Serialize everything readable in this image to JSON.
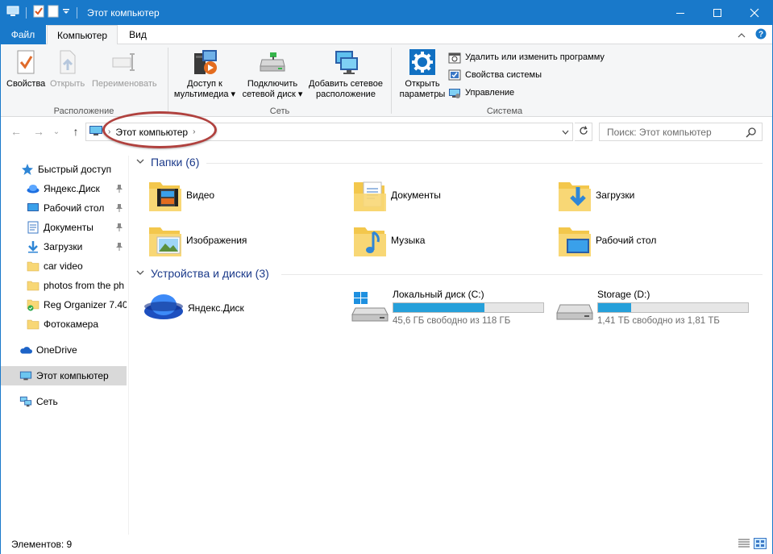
{
  "window": {
    "title": "Этот компьютер",
    "minimize_glyph": "—",
    "maximize_glyph": "☐",
    "close_glyph": "✕"
  },
  "ribbon_tabs": {
    "file": "Файл",
    "computer": "Компьютер",
    "view": "Вид"
  },
  "ribbon": {
    "location_group": {
      "label": "Расположение",
      "properties": "Свойства",
      "open": "Открыть",
      "rename": "Переименовать"
    },
    "network_group": {
      "label": "Сеть",
      "media_access_line1": "Доступ к",
      "media_access_line2": "мультимедиа",
      "map_drive_line1": "Подключить",
      "map_drive_line2": "сетевой диск",
      "add_location_line1": "Добавить сетевое",
      "add_location_line2": "расположение"
    },
    "system_group": {
      "label": "Система",
      "open_settings_line1": "Открыть",
      "open_settings_line2": "параметры",
      "uninstall": "Удалить или изменить программу",
      "system_properties": "Свойства системы",
      "manage": "Управление"
    },
    "dropdown_glyph": "▾"
  },
  "address": {
    "crumb": "Этот компьютер",
    "chevron": "›",
    "search_placeholder": "Поиск: Этот компьютер"
  },
  "nav": {
    "back": "←",
    "forward": "→",
    "recent": "⌄",
    "up": "↑",
    "items": [
      {
        "label": "Быстрый доступ",
        "icon": "star-icon",
        "pinned": false
      },
      {
        "label": "Яндекс.Диск",
        "icon": "yandex-disk-icon",
        "pinned": true
      },
      {
        "label": "Рабочий стол",
        "icon": "desktop-icon",
        "pinned": true
      },
      {
        "label": "Документы",
        "icon": "documents-icon",
        "pinned": true
      },
      {
        "label": "Загрузки",
        "icon": "downloads-icon",
        "pinned": true
      },
      {
        "label": "car video",
        "icon": "folder-icon",
        "pinned": false
      },
      {
        "label": "photos from the ph",
        "icon": "folder-icon",
        "pinned": false
      },
      {
        "label": "Reg Organizer 7.40",
        "icon": "folder-check-icon",
        "pinned": false
      },
      {
        "label": "Фотокамера",
        "icon": "folder-icon",
        "pinned": false
      },
      {
        "label": "OneDrive",
        "icon": "onedrive-icon",
        "pinned": false
      },
      {
        "label": "Этот компьютер",
        "icon": "this-pc-icon",
        "pinned": false
      },
      {
        "label": "Сеть",
        "icon": "network-icon",
        "pinned": false
      }
    ]
  },
  "content": {
    "folders_header": "Папки (6)",
    "folders": [
      {
        "label": "Видео",
        "icon": "video-folder-icon"
      },
      {
        "label": "Документы",
        "icon": "documents-folder-icon"
      },
      {
        "label": "Загрузки",
        "icon": "downloads-folder-icon"
      },
      {
        "label": "Изображения",
        "icon": "pictures-folder-icon"
      },
      {
        "label": "Музыка",
        "icon": "music-folder-icon"
      },
      {
        "label": "Рабочий стол",
        "icon": "desktop-folder-icon"
      }
    ],
    "devices_header": "Устройства и диски (3)",
    "yandex": {
      "label": "Яндекс.Диск"
    },
    "drives": [
      {
        "label": "Локальный диск (C:)",
        "free": "45,6 ГБ свободно из 118 ГБ",
        "used_fraction": 0.61,
        "icon": "windows-drive-icon"
      },
      {
        "label": "Storage (D:)",
        "free": "1,41 ТБ свободно из 1,81 ТБ",
        "used_fraction": 0.22,
        "icon": "hard-drive-icon"
      }
    ]
  },
  "status": {
    "items_count": "Элементов: 9"
  },
  "colors": {
    "accent": "#1979ca",
    "drive_bar": "#26a0da",
    "highlight_ring": "#b0413e"
  }
}
